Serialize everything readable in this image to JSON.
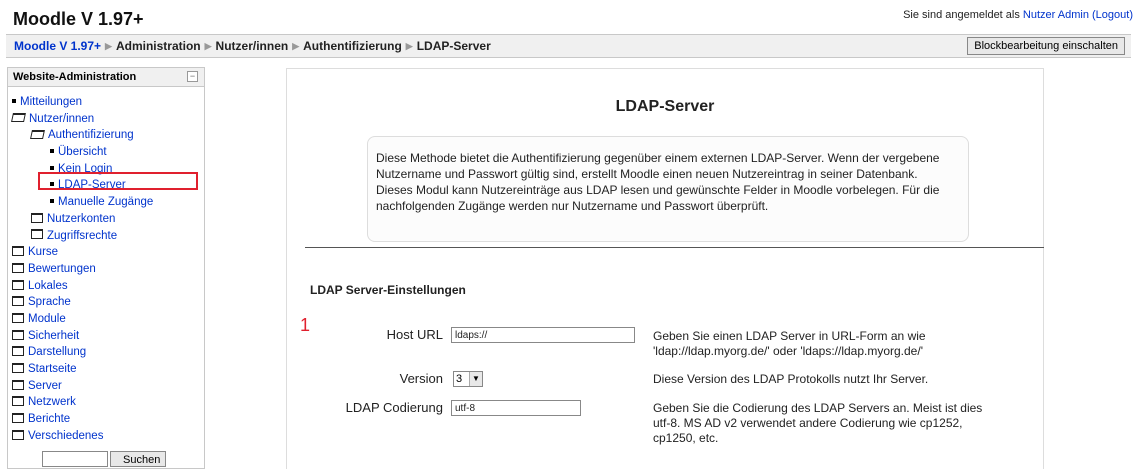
{
  "header": {
    "site_title": "Moodle V 1.97+",
    "login_prefix": "Sie sind angemeldet als",
    "user_name": "Nutzer Admin",
    "logout": "(Logout)"
  },
  "navbar": {
    "breadcrumb": [
      "Moodle V 1.97+",
      "Administration",
      "Nutzer/innen",
      "Authentifizierung",
      "LDAP-Server"
    ],
    "separator": "▶",
    "block_edit_button": "Blockbearbeitung einschalten"
  },
  "sidebar": {
    "title": "Website-Administration",
    "collapse_symbol": "−",
    "items": [
      {
        "label": "Mitteilungen",
        "level": 0,
        "type": "leaf"
      },
      {
        "label": "Nutzer/innen",
        "level": 0,
        "type": "folder-open"
      },
      {
        "label": "Authentifizierung",
        "level": 1,
        "type": "folder-open"
      },
      {
        "label": "Übersicht",
        "level": 2,
        "type": "leaf"
      },
      {
        "label": "Kein Login",
        "level": 2,
        "type": "leaf"
      },
      {
        "label": "LDAP-Server",
        "level": 2,
        "type": "leaf"
      },
      {
        "label": "Manuelle Zugänge",
        "level": 2,
        "type": "leaf"
      },
      {
        "label": "Nutzerkonten",
        "level": 1,
        "type": "folder"
      },
      {
        "label": "Zugriffsrechte",
        "level": 1,
        "type": "folder"
      },
      {
        "label": "Kurse",
        "level": 0,
        "type": "folder"
      },
      {
        "label": "Bewertungen",
        "level": 0,
        "type": "folder"
      },
      {
        "label": "Lokales",
        "level": 0,
        "type": "folder"
      },
      {
        "label": "Sprache",
        "level": 0,
        "type": "folder"
      },
      {
        "label": "Module",
        "level": 0,
        "type": "folder"
      },
      {
        "label": "Sicherheit",
        "level": 0,
        "type": "folder"
      },
      {
        "label": "Darstellung",
        "level": 0,
        "type": "folder"
      },
      {
        "label": "Startseite",
        "level": 0,
        "type": "folder"
      },
      {
        "label": "Server",
        "level": 0,
        "type": "folder"
      },
      {
        "label": "Netzwerk",
        "level": 0,
        "type": "folder"
      },
      {
        "label": "Berichte",
        "level": 0,
        "type": "folder"
      },
      {
        "label": "Verschiedenes",
        "level": 0,
        "type": "folder"
      }
    ],
    "search_button": "Suchen"
  },
  "main": {
    "title": "LDAP-Server",
    "description": "Diese Methode bietet die Authentifizierung gegenüber einem externen LDAP-Server. Wenn der vergebene Nutzername und Passwort gültig sind, erstellt Moodle einen neuen Nutzereintrag in seiner Datenbank. Dieses Modul kann Nutzereinträge aus LDAP lesen und gewünschte Felder in Moodle vorbelegen. Für die nachfolgenden Zugänge werden nur Nutzername und Passwort überprüft.",
    "section_heading": "LDAP Server-Einstellungen",
    "marker": "1",
    "fields": {
      "host_url": {
        "label": "Host URL",
        "value": "ldaps://",
        "help": "Geben Sie einen LDAP Server in URL-Form an wie 'ldap://ldap.myorg.de/' oder 'ldaps://ldap.myorg.de/'"
      },
      "version": {
        "label": "Version",
        "value": "3",
        "help": "Diese Version des LDAP Protokolls nutzt Ihr Server."
      },
      "encoding": {
        "label": "LDAP Codierung",
        "value": "utf-8",
        "help": "Geben Sie die Codierung des LDAP Servers an. Meist ist dies utf-8. MS AD v2 verwendet andere Codierung wie cp1252, cp1250, etc."
      }
    }
  },
  "colors": {
    "link": "#0033cc",
    "highlight": "#e0202e",
    "navbar_bg": "#f0f0f0"
  }
}
